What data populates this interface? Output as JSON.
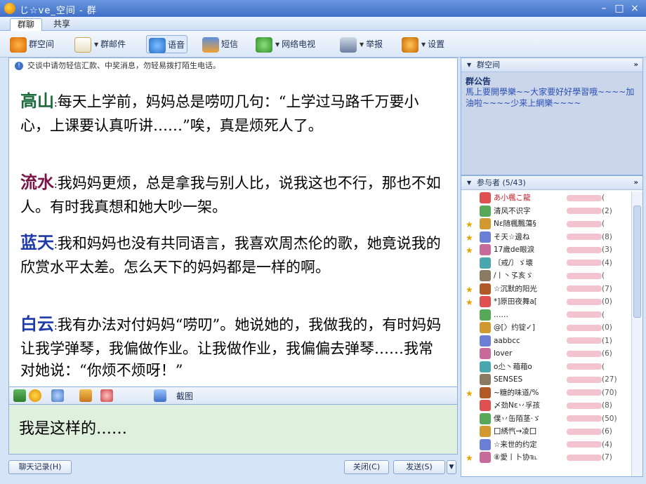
{
  "window": {
    "title": "じ☆ve_空间 - 群"
  },
  "window_controls": {
    "minimize": "–",
    "maximize": "□",
    "close": "×"
  },
  "tabs": [
    {
      "label": "群聊"
    },
    {
      "label": "共享"
    }
  ],
  "toolbar": [
    {
      "label": "群空间",
      "icon": "group-space-icon"
    },
    {
      "label": "群邮件",
      "icon": "mail-icon"
    },
    {
      "label": "语音",
      "icon": "voice-icon"
    },
    {
      "label": "短信",
      "icon": "sms-icon"
    },
    {
      "label": "网络电视",
      "icon": "tv-icon"
    },
    {
      "label": "举报",
      "icon": "report-icon"
    },
    {
      "label": "设置",
      "icon": "settings-icon"
    }
  ],
  "chat": {
    "notice": "交谈中请勿轻信汇款、中奖消息，勿轻易拨打陌生电话。",
    "messages": [
      {
        "speaker": "高山",
        "color": "#1b6b3a",
        "text": "每天上学前，妈妈总是唠叨几句：“上学过马路千万要小心，上课要认真听讲……”唉，真是烦死人了。"
      },
      {
        "speaker": "流水",
        "color": "#7a1346",
        "text": "我妈妈更烦，总是拿我与别人比，说我这也不行，那也不如人。有时我真想和她大吵一架。"
      },
      {
        "speaker": "蓝天",
        "color": "#1d3aa8",
        "text": "我和妈妈也没有共同语言，我喜欢周杰伦的歌，她竟说我的欣赏水平太差。怎么天下的妈妈都是一样的啊。"
      },
      {
        "speaker": "白云",
        "color": "#1d3aa8",
        "text": "我有办法对付妈妈“唠叨”。她说她的，我做我的，有时妈妈让我学弹琴，我偏做作业。让我做作业，我偏偏去弹琴……我常对她说：“你烦不烦呀！”"
      }
    ]
  },
  "input_toolbar": {
    "screenshot_label": "截图"
  },
  "input": {
    "text": "我是这样的……"
  },
  "bottom": {
    "history": "聊天记录(H)",
    "close": "关闭(C)",
    "send": "发送(S)"
  },
  "bulletin": {
    "header": "群空间",
    "title": "群公告",
    "text": "馬上要開學樂~~大家要好好學習哦~~~~加油啦~~~~少来上網樂~~~~"
  },
  "members": {
    "header": "参与者 (5/43)",
    "list": [
      {
        "name": "あ小楓こ龍",
        "id": "(",
        "star": false
      },
      {
        "name": "清风不识字",
        "id": "(2)",
        "star": false
      },
      {
        "name": "Nε随楓飄蕩§",
        "id": "(",
        "star": true
      },
      {
        "name": "そ天☆邊ね",
        "id": "(8)",
        "star": true
      },
      {
        "name": "17歲de眼淚",
        "id": "(3)",
        "star": true
      },
      {
        "name": "〔戒/〕ゞ壊",
        "id": "(4)",
        "star": false
      },
      {
        "name": "/丨丶孓亥ゞ",
        "id": "(",
        "star": false
      },
      {
        "name": "☆沉默的阳光",
        "id": "(7)",
        "star": true
      },
      {
        "name": "*]原田夜舞a[",
        "id": "(0)",
        "star": true
      },
      {
        "name": "……",
        "id": "(",
        "star": false
      },
      {
        "name": "@[〉约锭✓]",
        "id": "(0)",
        "star": false
      },
      {
        "name": "aabbcc",
        "id": "(1)",
        "star": false
      },
      {
        "name": "lover",
        "id": "(6)",
        "star": false
      },
      {
        "name": "o尐丶葙葙o",
        "id": "(",
        "star": false
      },
      {
        "name": "SENSES",
        "id": "(27)",
        "star": false
      },
      {
        "name": "~糖的味道/%",
        "id": "(70)",
        "star": true
      },
      {
        "name": "〆劲Nε丷孚孩",
        "id": "(8)",
        "star": false
      },
      {
        "name": "僕丷缶陌茎·ゞ",
        "id": "(50)",
        "star": false
      },
      {
        "name": "囗綉忾→凌囗",
        "id": "(6)",
        "star": false
      },
      {
        "name": "☆来世的约定",
        "id": "(4)",
        "star": false
      },
      {
        "name": "⑧愛丨卜协℡",
        "id": "(7)",
        "star": true
      }
    ]
  }
}
